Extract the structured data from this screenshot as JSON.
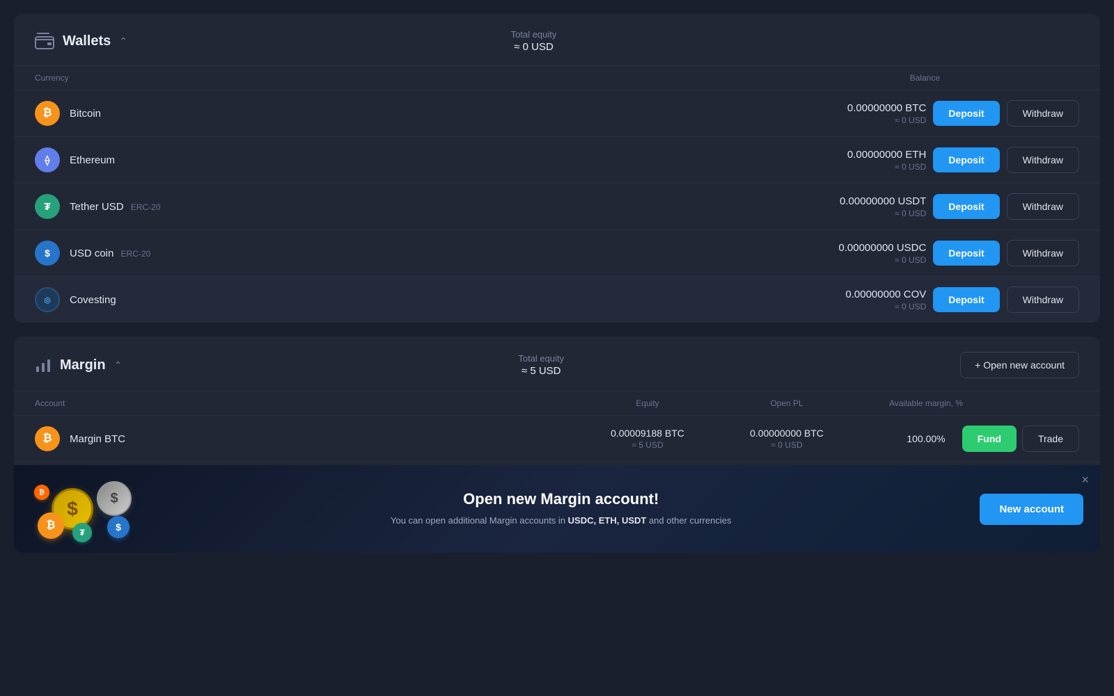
{
  "wallets": {
    "title": "Wallets",
    "total_equity_label": "Total equity",
    "total_equity_value": "≈ 0 USD",
    "table_headers": {
      "currency": "Currency",
      "balance": "Balance"
    },
    "currencies": [
      {
        "id": "btc",
        "name": "Bitcoin",
        "tag": "",
        "icon_symbol": "₿",
        "icon_class": "btc-icon",
        "balance_main": "0.00000000 BTC",
        "balance_usd": "≈ 0 USD",
        "deposit_label": "Deposit",
        "withdraw_label": "Withdraw"
      },
      {
        "id": "eth",
        "name": "Ethereum",
        "tag": "",
        "icon_symbol": "⬡",
        "icon_class": "eth-icon",
        "balance_main": "0.00000000 ETH",
        "balance_usd": "≈ 0 USD",
        "deposit_label": "Deposit",
        "withdraw_label": "Withdraw"
      },
      {
        "id": "usdt",
        "name": "Tether USD",
        "tag": "ERC-20",
        "icon_symbol": "₮",
        "icon_class": "usdt-icon",
        "balance_main": "0.00000000 USDT",
        "balance_usd": "≈ 0 USD",
        "deposit_label": "Deposit",
        "withdraw_label": "Withdraw"
      },
      {
        "id": "usdc",
        "name": "USD coin",
        "tag": "ERC-20",
        "icon_symbol": "$",
        "icon_class": "usdc-icon",
        "balance_main": "0.00000000 USDC",
        "balance_usd": "≈ 0 USD",
        "deposit_label": "Deposit",
        "withdraw_label": "Withdraw"
      },
      {
        "id": "cov",
        "name": "Covesting",
        "tag": "",
        "icon_symbol": "◎",
        "icon_class": "cov-icon",
        "balance_main": "0.00000000 COV",
        "balance_usd": "≈ 0 USD",
        "deposit_label": "Deposit",
        "withdraw_label": "Withdraw",
        "highlighted": true
      }
    ]
  },
  "margin": {
    "title": "Margin",
    "total_equity_label": "Total equity",
    "total_equity_value": "≈ 5 USD",
    "open_new_account_label": "+ Open new account",
    "table_headers": {
      "account": "Account",
      "equity": "Equity",
      "open_pl": "Open PL",
      "available_margin": "Available margin, %"
    },
    "accounts": [
      {
        "id": "margin-btc",
        "name": "Margin BTC",
        "icon_class": "btc-icon",
        "icon_symbol": "₿",
        "equity_main": "0.00009188 BTC",
        "equity_usd": "≈ 5 USD",
        "open_pl_main": "0.00000000 BTC",
        "open_pl_usd": "≈ 0 USD",
        "available_margin": "100.00%",
        "fund_label": "Fund",
        "trade_label": "Trade"
      }
    ],
    "promo": {
      "title": "Open new Margin account!",
      "description": "You can open additional Margin accounts in ",
      "description_currencies": "USDC, ETH, USDT",
      "description_suffix": " and other currencies",
      "new_account_label": "New account",
      "close_label": "×"
    }
  }
}
